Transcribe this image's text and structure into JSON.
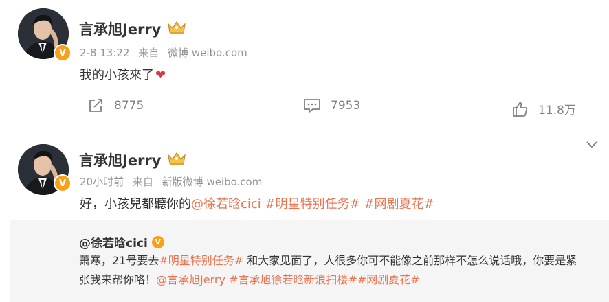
{
  "post1": {
    "username": "言承旭Jerry",
    "time": "2-8 13:22",
    "source_prefix": "来自",
    "source": "微博 weibo.com",
    "text": "我的小孩來了",
    "heart": "❤",
    "actions": {
      "repost_count": "8775",
      "comment_count": "7953",
      "like_count": "11.8万"
    }
  },
  "post2": {
    "username": "言承旭Jerry",
    "time": "20小时前",
    "source_prefix": "来自",
    "source": "新版微博 weibo.com",
    "text_plain": "好，小孩兒都聽你的",
    "mention": "@徐若晗cici",
    "tag1": "#明星特别任务#",
    "tag2": "#网剧夏花#",
    "repost": {
      "username": "@徐若晗cici",
      "line1_a": "萧寒，21号要去",
      "line1_tag": "#明星特别任务#",
      "line1_b": " 和大家见面了，人很多你可不能像之前那样不怎么说话哦，你要是紧",
      "line2_a": "张我来帮你咯！",
      "line2_mention": "@言承旭Jerry",
      "line2_tags": " #言承旭徐若晗新浪扫楼##网剧夏花#"
    }
  },
  "icons": {
    "verified": "V",
    "crown": "crown-icon",
    "repost": "share-icon",
    "comment": "comment-icon",
    "like": "thumbs-up-icon",
    "menu": "chevron-down-icon"
  },
  "colors": {
    "link": "#eb7350",
    "meta": "#939393",
    "verified": "#f7a11a",
    "heart": "#e0353e",
    "repost_bg": "#f5f5f5"
  }
}
